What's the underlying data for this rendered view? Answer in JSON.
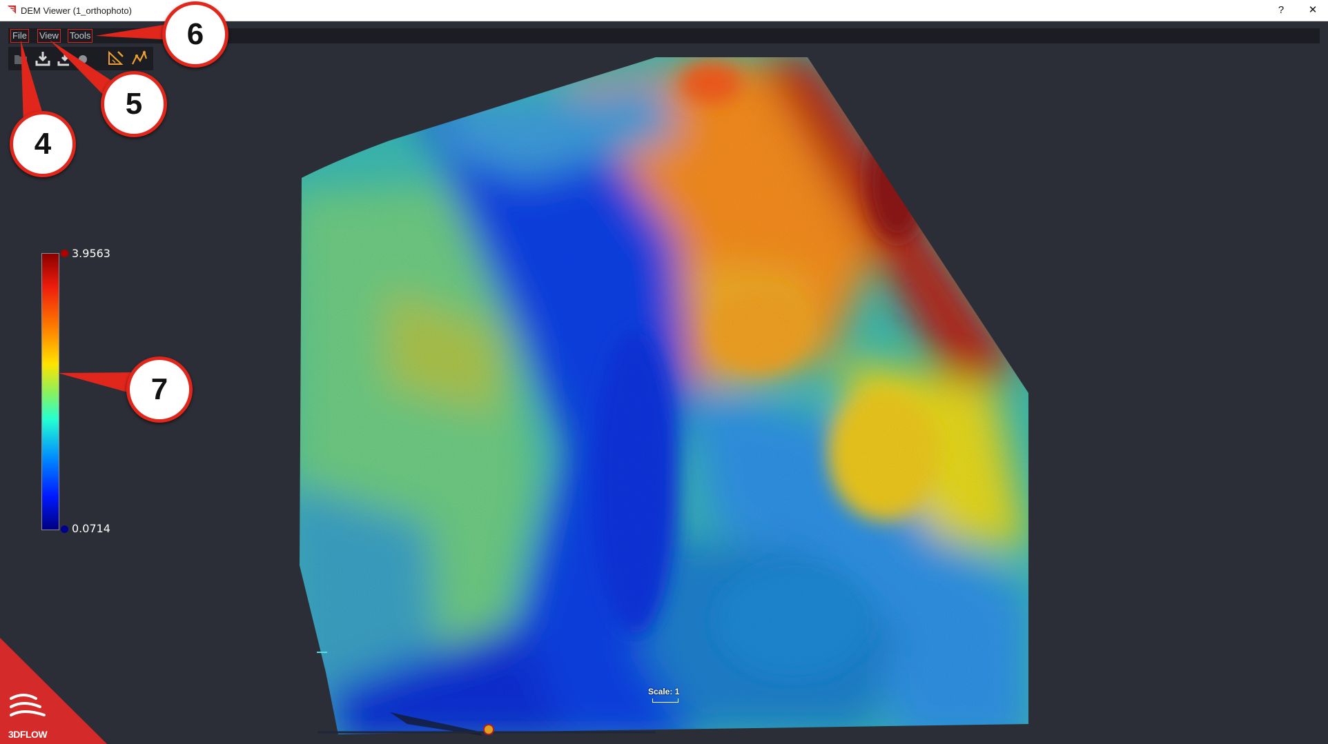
{
  "window": {
    "title": "DEM Viewer (1_orthophoto)",
    "help_label": "?",
    "close_label": "✕"
  },
  "menu": {
    "file": "File",
    "view": "View",
    "tools": "Tools"
  },
  "toolbar": {
    "buttons": [
      {
        "icon": "open-folder-icon"
      },
      {
        "icon": "export-download-icon"
      },
      {
        "icon": "export-alt-icon"
      },
      {
        "icon": "clear-icon"
      },
      {
        "icon": "ruler-measure-icon"
      },
      {
        "icon": "elevation-profile-icon"
      }
    ]
  },
  "colorbar": {
    "max_label": "3.9563",
    "min_label": "0.0714",
    "max_value": 3.9563,
    "min_value": 0.0714,
    "colormap": "jet",
    "colors": [
      "#8a0000",
      "#ee1d0c",
      "#ff7f00",
      "#ffe300",
      "#8ef05a",
      "#25ffd2",
      "#008cff",
      "#0019ff",
      "#00007f"
    ]
  },
  "scale": {
    "label": "Scale: 1"
  },
  "callouts": [
    "4",
    "5",
    "6",
    "7"
  ],
  "brand": {
    "name": "3DFLOW",
    "color": "#d42a2a"
  },
  "colors": {
    "background": "#2b2e36",
    "menubar": "#1b1d22",
    "accent_red": "#e1261c",
    "toolbar_icon": "#d8d8d8",
    "toolbar_icon_orange": "#f0a030"
  }
}
